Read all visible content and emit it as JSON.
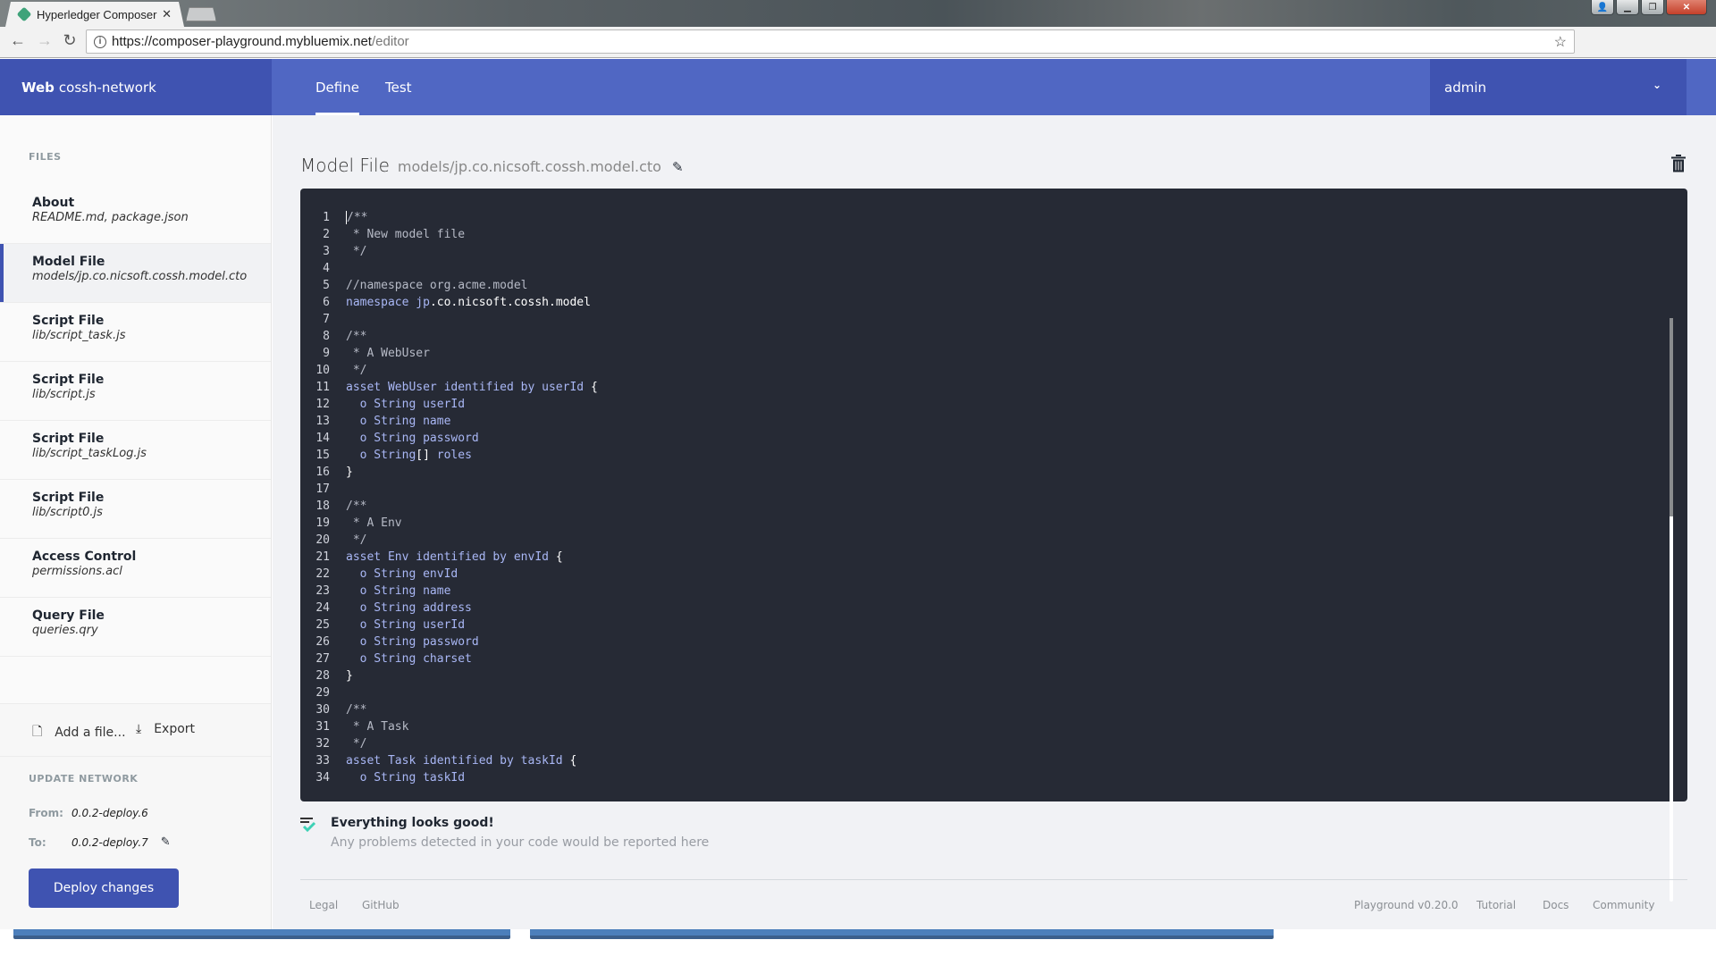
{
  "browser": {
    "tab_title": "Hyperledger Composer",
    "url_host": "https://composer-playground.mybluemix.net",
    "url_path": "/editor",
    "extensions": [
      "s-extension-icon",
      "target-extension-icon",
      "react-extension-icon",
      "bracket-heart-extension-icon"
    ]
  },
  "header": {
    "brand_bold": "Web",
    "brand_name": "cossh-network",
    "tabs": [
      {
        "label": "Define",
        "active": true
      },
      {
        "label": "Test",
        "active": false
      }
    ],
    "user": "admin"
  },
  "sidebar": {
    "files_heading": "FILES",
    "files": [
      {
        "title": "About",
        "sub": "README.md, package.json",
        "active": false
      },
      {
        "title": "Model File",
        "sub": "models/jp.co.nicsoft.cossh.model.cto",
        "active": true
      },
      {
        "title": "Script File",
        "sub": "lib/script_task.js",
        "active": false
      },
      {
        "title": "Script File",
        "sub": "lib/script.js",
        "active": false
      },
      {
        "title": "Script File",
        "sub": "lib/script_taskLog.js",
        "active": false
      },
      {
        "title": "Script File",
        "sub": "lib/script0.js",
        "active": false
      },
      {
        "title": "Access Control",
        "sub": "permissions.acl",
        "active": false
      },
      {
        "title": "Query File",
        "sub": "queries.qry",
        "active": false
      }
    ],
    "add_file_label": "Add a file...",
    "export_label": "Export",
    "update_heading": "UPDATE NETWORK",
    "from_label": "From:",
    "from_value": "0.0.2-deploy.6",
    "to_label": "To:",
    "to_value": "0.0.2-deploy.7",
    "deploy_label": "Deploy changes"
  },
  "editor": {
    "file_type": "Model File",
    "file_path": "models/jp.co.nicsoft.cossh.model.cto",
    "lines": [
      [
        [
          "cm",
          "/**"
        ]
      ],
      [
        [
          "cm",
          " * New model file"
        ]
      ],
      [
        [
          "cm",
          " */"
        ]
      ],
      [],
      [
        [
          "cm",
          "//namespace org.acme.model"
        ]
      ],
      [
        [
          "kw",
          "namespace "
        ],
        [
          "kw",
          "jp"
        ],
        [
          "id",
          ".co.nicsoft.cossh.model"
        ]
      ],
      [],
      [
        [
          "cm",
          "/**"
        ]
      ],
      [
        [
          "cm",
          " * A WebUser"
        ]
      ],
      [
        [
          "cm",
          " */"
        ]
      ],
      [
        [
          "kw",
          "asset WebUser identified by userId "
        ],
        [
          "id",
          "{"
        ]
      ],
      [
        [
          "kw",
          "  o String userId"
        ]
      ],
      [
        [
          "kw",
          "  o String name"
        ]
      ],
      [
        [
          "kw",
          "  o String password"
        ]
      ],
      [
        [
          "kw",
          "  o String"
        ],
        [
          "id",
          "[]"
        ],
        [
          "kw",
          " roles"
        ]
      ],
      [
        [
          "id",
          "}"
        ]
      ],
      [],
      [
        [
          "cm",
          "/**"
        ]
      ],
      [
        [
          "cm",
          " * A Env"
        ]
      ],
      [
        [
          "cm",
          " */"
        ]
      ],
      [
        [
          "kw",
          "asset Env identified by envId "
        ],
        [
          "id",
          "{"
        ]
      ],
      [
        [
          "kw",
          "  o String envId"
        ]
      ],
      [
        [
          "kw",
          "  o String name"
        ]
      ],
      [
        [
          "kw",
          "  o String address"
        ]
      ],
      [
        [
          "kw",
          "  o String userId"
        ]
      ],
      [
        [
          "kw",
          "  o String password"
        ]
      ],
      [
        [
          "kw",
          "  o String charset"
        ]
      ],
      [
        [
          "id",
          "}"
        ]
      ],
      [],
      [
        [
          "cm",
          "/**"
        ]
      ],
      [
        [
          "cm",
          " * A Task"
        ]
      ],
      [
        [
          "cm",
          " */"
        ]
      ],
      [
        [
          "kw",
          "asset Task identified by taskId "
        ],
        [
          "id",
          "{"
        ]
      ],
      [
        [
          "kw",
          "  o String taskId"
        ]
      ]
    ],
    "scroll_fraction_visible": 0.34
  },
  "status": {
    "title": "Everything looks good!",
    "subtitle": "Any problems detected in your code would be reported here"
  },
  "footer": {
    "left": [
      "Legal",
      "GitHub"
    ],
    "right": [
      "Playground v0.20.0",
      "Tutorial",
      "Docs",
      "Community"
    ]
  }
}
